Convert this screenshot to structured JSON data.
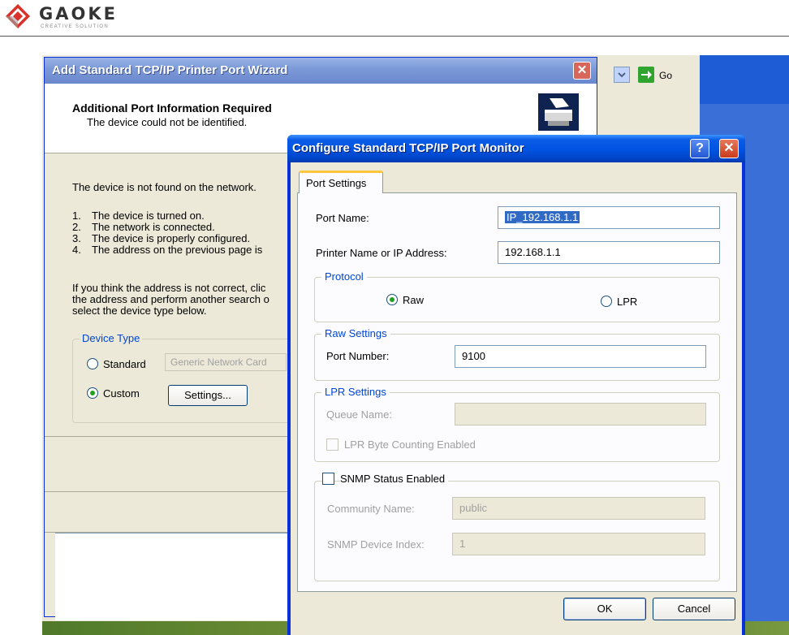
{
  "doc_header": {
    "logo_word": "GAOKE",
    "logo_tagline": "CREATIVE SOLUTION"
  },
  "browser": {
    "go_label": "Go"
  },
  "wizard": {
    "title": "Add Standard TCP/IP Printer Port Wizard",
    "close_glyph": "✕",
    "heading": "Additional Port Information Required",
    "subheading": "The device could not be identified.",
    "message": "The device is not found on the network.",
    "checklist": [
      {
        "num": "1.",
        "text": "The device is turned on."
      },
      {
        "num": "2.",
        "text": "The network is connected."
      },
      {
        "num": "3.",
        "text": "The device is properly configured."
      },
      {
        "num": "4.",
        "text": "The address on the previous page is"
      }
    ],
    "paragraph": [
      "If you think the address is not correct, clic",
      "the address and perform another search o",
      "select the device type below."
    ],
    "device_type": {
      "legend": "Device Type",
      "standard_label": "Standard",
      "standard_value": "Generic Network Card",
      "custom_label": "Custom",
      "settings_button": "Settings...",
      "selected": "Custom"
    }
  },
  "dialog": {
    "title": "Configure Standard TCP/IP Port Monitor",
    "help_glyph": "?",
    "close_glyph": "✕",
    "tab_label": "Port Settings",
    "port_name_label": "Port Name:",
    "port_name_value": "IP_192.168.1.1",
    "printer_label": "Printer Name or IP Address:",
    "printer_value": "192.168.1.1",
    "protocol": {
      "legend": "Protocol",
      "raw_label": "Raw",
      "lpr_label": "LPR",
      "selected": "Raw"
    },
    "raw_settings": {
      "legend": "Raw Settings",
      "port_number_label": "Port Number:",
      "port_number_value": "9100"
    },
    "lpr_settings": {
      "legend": "LPR Settings",
      "queue_name_label": "Queue Name:",
      "queue_name_value": "",
      "byte_counting_label": "LPR Byte Counting Enabled",
      "byte_counting_checked": false
    },
    "snmp": {
      "legend": "SNMP Status Enabled",
      "enabled": false,
      "community_label": "Community Name:",
      "community_value": "public",
      "index_label": "SNMP Device Index:",
      "index_value": "1"
    },
    "ok_label": "OK",
    "cancel_label": "Cancel"
  },
  "colors": {
    "xp_blue": "#0054e3",
    "legend_blue": "#0046d5",
    "dialog_face": "#ece9d8",
    "selection": "#316ac5",
    "radio_green": "#21a121"
  }
}
